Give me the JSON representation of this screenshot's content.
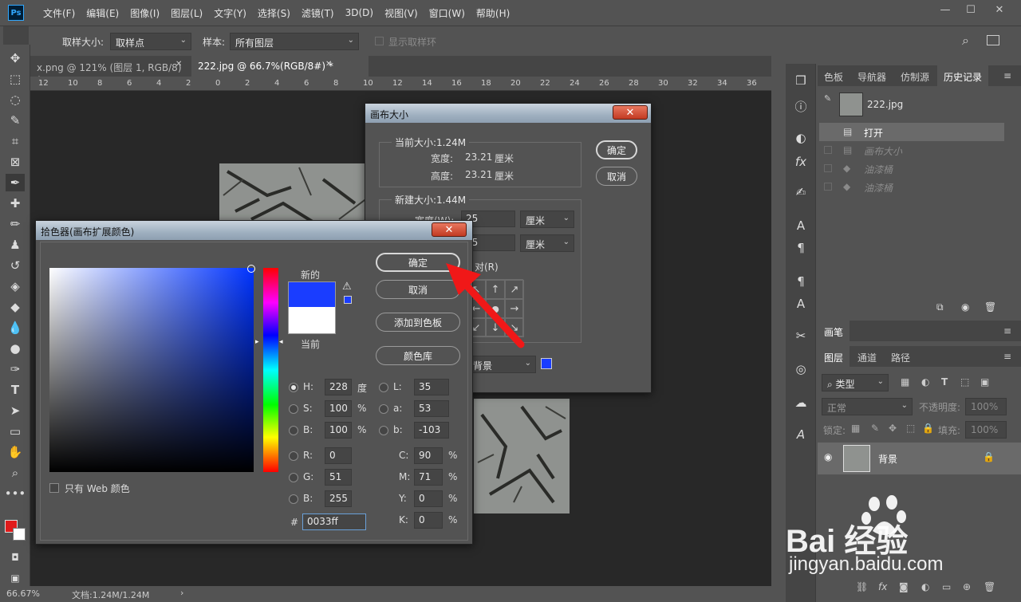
{
  "menu": [
    "文件(F)",
    "编辑(E)",
    "图像(I)",
    "图层(L)",
    "文字(Y)",
    "选择(S)",
    "滤镜(T)",
    "3D(D)",
    "视图(V)",
    "窗口(W)",
    "帮助(H)"
  ],
  "app_logo": "Ps",
  "window_controls": {
    "minimize": "—",
    "restore": "☐",
    "close": "✕"
  },
  "options": {
    "sample_size_label": "取样大小:",
    "sample_size_value": "取样点",
    "sample_label": "样本:",
    "sample_value": "所有图层",
    "show_ring_label": "显示取样环"
  },
  "tabs": [
    {
      "label": "x.png @ 121% (图层 1, RGB/8) *",
      "close": "✕"
    },
    {
      "label": "222.jpg @ 66.7%(RGB/8#) *",
      "close": "✕"
    }
  ],
  "ruler_ticks": [
    "12",
    "10",
    "8",
    "6",
    "4",
    "2",
    "0",
    "2",
    "4",
    "6",
    "8",
    "10",
    "12",
    "14",
    "16",
    "18",
    "20",
    "22",
    "24",
    "26",
    "28",
    "30",
    "32",
    "34",
    "36"
  ],
  "status": {
    "zoom": "66.67%",
    "doc": "文档:1.24M/1.24M"
  },
  "panels": {
    "top_tabs": [
      "色板",
      "导航器",
      "仿制源",
      "历史记录"
    ],
    "history_file": "222.jpg",
    "history_items": [
      "打开",
      "画布大小",
      "油漆桶",
      "油漆桶"
    ],
    "brush_tab": "画笔",
    "layer_tabs": [
      "图层",
      "通道",
      "路径"
    ],
    "layer_filter": "类型",
    "blend_mode": "正常",
    "opacity_label": "不透明度:",
    "opacity_value": "100%",
    "lock_label": "锁定:",
    "fill_label": "填充:",
    "fill_value": "100%",
    "layer_name": "背景"
  },
  "canvas_size_dialog": {
    "title": "画布大小",
    "current_size_label": "当前大小:1.24M",
    "width_label": "宽度:",
    "width_value": "23.21",
    "width_unit": "厘米",
    "height_label": "高度:",
    "height_value": "23.21",
    "height_unit": "厘米",
    "new_size_label": "新建大小:1.44M",
    "new_width_label": "宽度(W):",
    "new_width_value": "25",
    "new_height_value": "25",
    "unit": "厘米",
    "relative_label": "对(R)",
    "bg_value": "背景",
    "ok": "确定",
    "cancel": "取消"
  },
  "color_picker": {
    "title": "拾色器(画布扩展颜色)",
    "new_label": "新的",
    "current_label": "当前",
    "ok": "确定",
    "cancel": "取消",
    "add_swatch": "添加到色板",
    "color_lib": "颜色库",
    "H": "228",
    "H_unit": "度",
    "S": "100",
    "S_unit": "%",
    "B": "100",
    "B_unit": "%",
    "R": "0",
    "G": "51",
    "Bv": "255",
    "L": "35",
    "a": "53",
    "b": "-103",
    "C": "90",
    "M": "71",
    "Y": "0",
    "K": "0",
    "hex": "0033ff",
    "web_only": "只有 Web 颜色",
    "new_color": "#1a3dff",
    "current_color": "#ffffff"
  },
  "watermark": {
    "brand": "Bai 经验",
    "url": "jingyan.baidu.com"
  }
}
